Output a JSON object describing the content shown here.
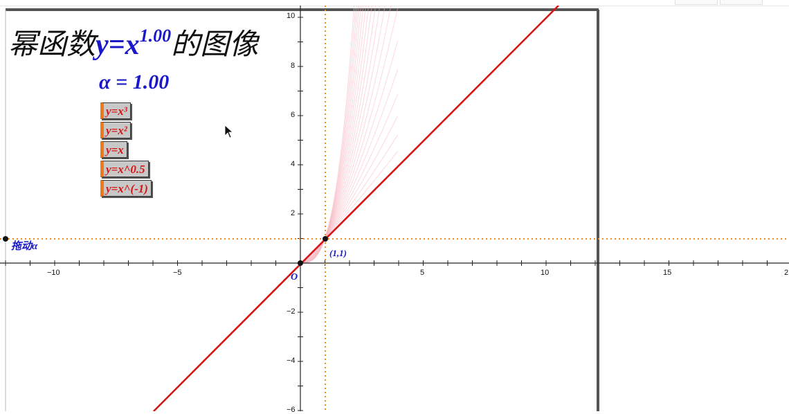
{
  "title": {
    "prefix": "幂函数",
    "expr": "y=x",
    "exponent": "1.00",
    "suffix": "的图像"
  },
  "alpha_display": "α = 1.00",
  "buttons": [
    {
      "label": "y=x³"
    },
    {
      "label": "y=x²"
    },
    {
      "label": "y=x"
    },
    {
      "label": "y=x^0.5"
    },
    {
      "label": "y=x^(-1)"
    }
  ],
  "slider_label": "拖动α",
  "point_label": "(1,1)",
  "origin_label": "O",
  "x_ticks": [
    "−10",
    "−5",
    "5",
    "10",
    "15",
    "2"
  ],
  "y_ticks": [
    "10",
    "8",
    "6",
    "4",
    "2",
    "−2",
    "−4",
    "−6"
  ],
  "colors": {
    "curve": "#d81414",
    "text_blue": "#1a18c9",
    "guide": "#f08c1e",
    "trace": "#f7b8c3"
  }
}
